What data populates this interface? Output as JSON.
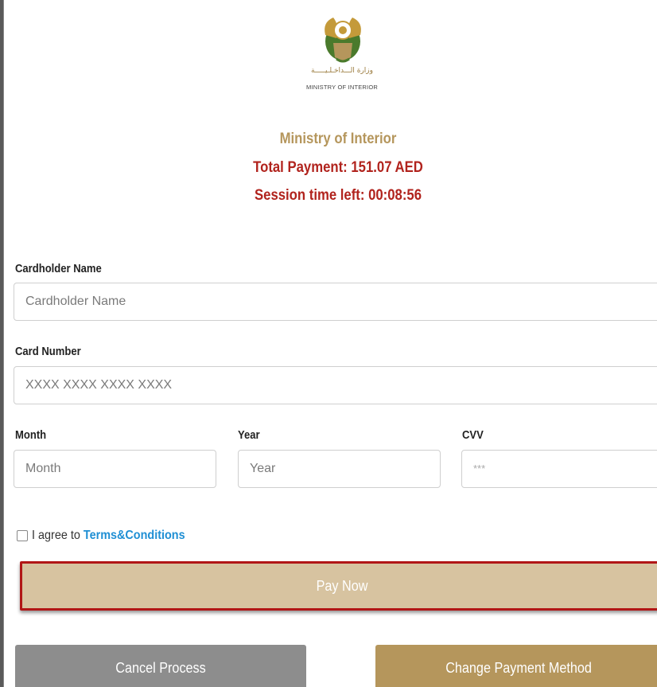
{
  "header": {
    "logo_arabic": "وزارة الـــداخـلـيـــــة",
    "logo_english": "MINISTRY OF INTERIOR",
    "merchant": "Ministry of Interior",
    "total_payment": "Total Payment: 151.07 AED",
    "session_time": "Session time left: 00:08:56"
  },
  "form": {
    "cardholder_label": "Cardholder Name",
    "cardholder_placeholder": "Cardholder Name",
    "card_number_label": "Card Number",
    "card_number_placeholder": "XXXX XXXX XXXX XXXX",
    "month_label": "Month",
    "month_placeholder": "Month",
    "year_label": "Year",
    "year_placeholder": "Year",
    "cvv_label": "CVV",
    "cvv_placeholder": "***",
    "agree_text": "I agree to",
    "terms_link": "Terms&Conditions"
  },
  "actions": {
    "pay_now": "Pay Now",
    "cancel": "Cancel Process",
    "change_method": "Change Payment Method"
  },
  "colors": {
    "gold": "#b5965c",
    "red": "#b1231d",
    "link": "#1f8fd4",
    "pay_button": "#d7c3a0",
    "cancel_button": "#8d8d8d"
  }
}
